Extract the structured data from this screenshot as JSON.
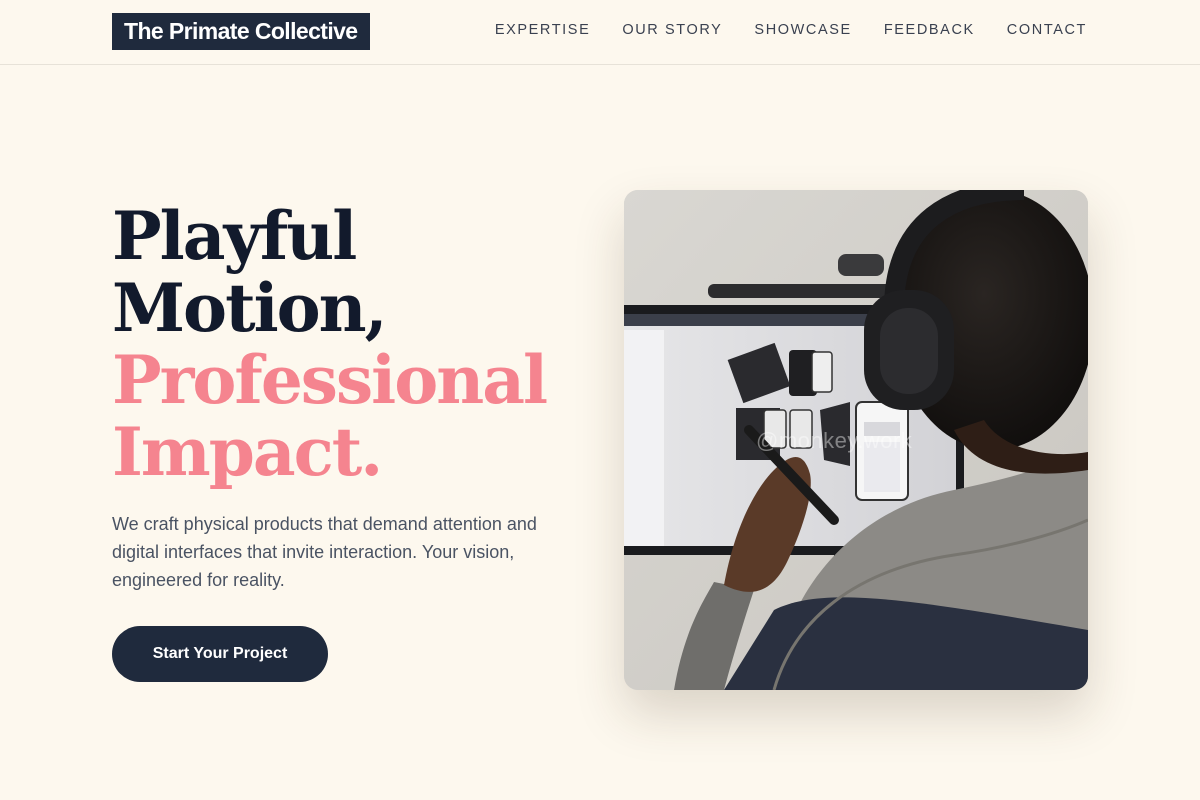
{
  "brand": {
    "name": "The Primate Collective"
  },
  "nav": {
    "items": [
      {
        "label": "EXPERTISE"
      },
      {
        "label": "OUR STORY"
      },
      {
        "label": "SHOWCASE"
      },
      {
        "label": "FEEDBACK"
      },
      {
        "label": "CONTACT"
      }
    ]
  },
  "hero": {
    "headline_line1": "Playful",
    "headline_line2": "Motion,",
    "headline_line3": "Professional",
    "headline_line4": "Impact.",
    "lead": "We craft physical products that demand attention and digital interfaces that invite interaction. Your vision, engineered for reality.",
    "cta_label": "Start Your Project",
    "image_watermark": "@monkey.work",
    "image_icon": "person-designing-at-monitor-photo"
  },
  "colors": {
    "background": "#fdf8ee",
    "navy": "#1f2a3d",
    "accent_pink": "#f5848f",
    "body_text": "#4a5363"
  }
}
